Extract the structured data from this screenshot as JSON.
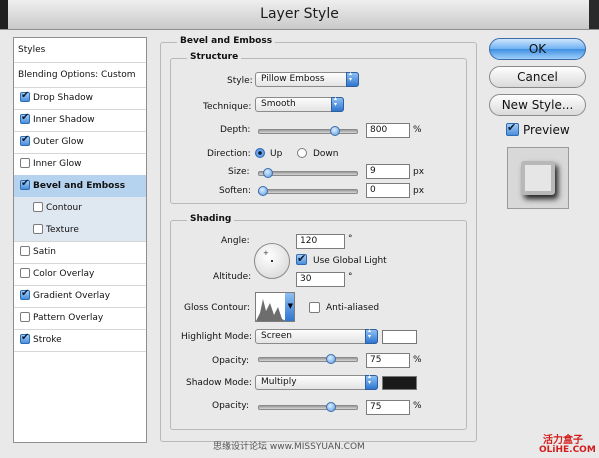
{
  "window": {
    "title": "Layer Style"
  },
  "sidebar": {
    "header": "Styles",
    "blending": "Blending Options: Custom",
    "items": [
      {
        "label": "Drop Shadow",
        "checked": true
      },
      {
        "label": "Inner Shadow",
        "checked": true
      },
      {
        "label": "Outer Glow",
        "checked": true
      },
      {
        "label": "Inner Glow",
        "checked": false
      },
      {
        "label": "Bevel and Emboss",
        "checked": true,
        "selected": true
      },
      {
        "label": "Contour",
        "checked": false,
        "sub": true
      },
      {
        "label": "Texture",
        "checked": false,
        "sub": true
      },
      {
        "label": "Satin",
        "checked": false
      },
      {
        "label": "Color Overlay",
        "checked": false
      },
      {
        "label": "Gradient Overlay",
        "checked": true
      },
      {
        "label": "Pattern Overlay",
        "checked": false
      },
      {
        "label": "Stroke",
        "checked": true
      }
    ]
  },
  "panel": {
    "title": "Bevel and Emboss",
    "structure": {
      "group_label": "Structure",
      "style_label": "Style:",
      "style_value": "Pillow Emboss",
      "technique_label": "Technique:",
      "technique_value": "Smooth",
      "depth_label": "Depth:",
      "depth_value": "800",
      "depth_unit": "%",
      "depth_level": 0.8,
      "direction_label": "Direction:",
      "up_label": "Up",
      "down_label": "Down",
      "direction": "Up",
      "size_label": "Size:",
      "size_value": "9",
      "size_unit": "px",
      "size_level": 0.06,
      "soften_label": "Soften:",
      "soften_value": "0",
      "soften_unit": "px",
      "soften_level": 0.0
    },
    "shading": {
      "group_label": "Shading",
      "angle_label": "Angle:",
      "angle_value": "120",
      "angle_unit": "°",
      "global_light_label": "Use Global Light",
      "global_light": true,
      "altitude_label": "Altitude:",
      "altitude_value": "30",
      "altitude_unit": "°",
      "gloss_label": "Gloss Contour:",
      "anti_aliased_label": "Anti-aliased",
      "anti_aliased": false,
      "highlight_mode_label": "Highlight Mode:",
      "highlight_mode_value": "Screen",
      "highlight_color": "#ffffff",
      "highlight_opacity_label": "Opacity:",
      "highlight_opacity_value": "75",
      "highlight_opacity_unit": "%",
      "highlight_opacity_level": 0.75,
      "shadow_mode_label": "Shadow Mode:",
      "shadow_mode_value": "Multiply",
      "shadow_color": "#1a1a1a",
      "shadow_opacity_label": "Opacity:",
      "shadow_opacity_value": "75",
      "shadow_opacity_unit": "%",
      "shadow_opacity_level": 0.75
    }
  },
  "buttons": {
    "ok": "OK",
    "cancel": "Cancel",
    "new_style": "New Style...",
    "preview_label": "Preview",
    "preview": true
  },
  "watermarks": {
    "left": "思缘设计论坛 www.MISSYUAN.COM",
    "right_top": "活力盒子",
    "right_bottom": "OLiHE.COM"
  }
}
